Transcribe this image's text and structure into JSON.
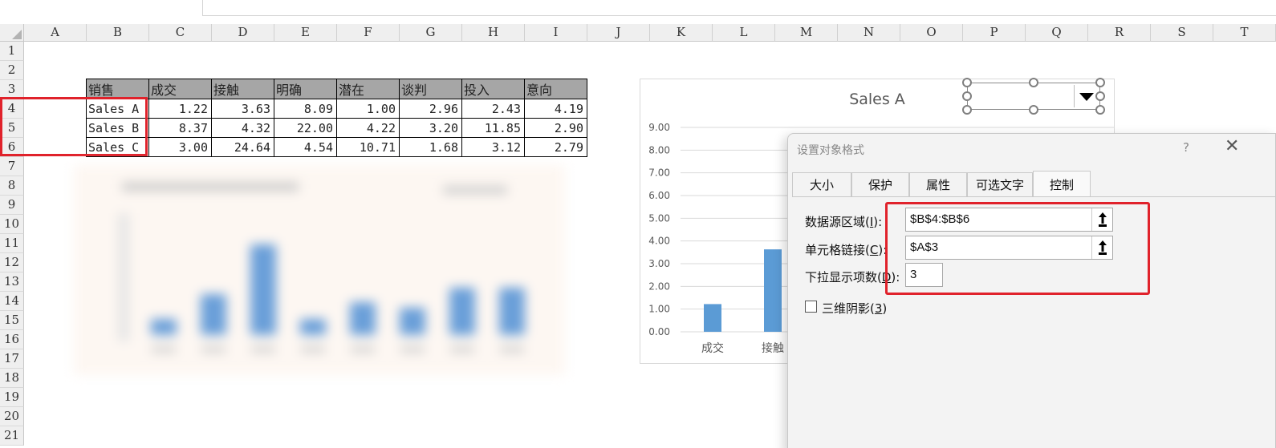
{
  "sheet": {
    "columns": [
      "A",
      "B",
      "C",
      "D",
      "E",
      "F",
      "G",
      "H",
      "I",
      "J",
      "K",
      "L",
      "M",
      "N",
      "O",
      "P",
      "Q",
      "R",
      "S",
      "T"
    ],
    "rows": [
      "1",
      "2",
      "3",
      "4",
      "5",
      "6",
      "7",
      "8",
      "9",
      "10",
      "11",
      "12",
      "13",
      "14",
      "15",
      "16",
      "17",
      "18",
      "19",
      "20",
      "21"
    ]
  },
  "table": {
    "headers": [
      "销售",
      "成交",
      "接触",
      "明确",
      "潜在",
      "谈判",
      "投入",
      "意向"
    ],
    "rows": [
      {
        "label": "Sales A",
        "values": [
          "1.22",
          "3.63",
          "8.09",
          "1.00",
          "2.96",
          "2.43",
          "4.19"
        ]
      },
      {
        "label": "Sales B",
        "values": [
          "8.37",
          "4.32",
          "22.00",
          "4.22",
          "3.20",
          "11.85",
          "2.90"
        ]
      },
      {
        "label": "Sales C",
        "values": [
          "3.00",
          "24.64",
          "4.54",
          "10.71",
          "1.68",
          "3.12",
          "2.79"
        ]
      }
    ]
  },
  "blurred_chart": {
    "values": [
      1.22,
      3.63,
      8.09,
      1.0,
      2.96,
      2.43,
      4.19,
      4.19
    ]
  },
  "chart_data": {
    "type": "bar",
    "title": "Sales A",
    "categories": [
      "成交",
      "接触"
    ],
    "values": [
      1.22,
      3.63
    ],
    "ylim": [
      0,
      9
    ],
    "yticks": [
      "0.00",
      "1.00",
      "2.00",
      "3.00",
      "4.00",
      "5.00",
      "6.00",
      "7.00",
      "8.00",
      "9.00"
    ],
    "bar_color": "#5b9bd5",
    "grid": true
  },
  "dialog": {
    "title": "设置对象格式",
    "help": "?",
    "close": "✕",
    "tabs": [
      "大小",
      "保护",
      "属性",
      "可选文字",
      "控制"
    ],
    "active_tab": "控制",
    "source_label": "数据源区域(",
    "source_key": "I",
    "source_tail": "):",
    "source_value": "$B$4:$B$6",
    "link_label": "单元格链接(",
    "link_key": "C",
    "link_tail": "):",
    "link_value": "$A$3",
    "dropdown_label": "下拉显示项数(",
    "dropdown_key": "D",
    "dropdown_tail": "):",
    "dropdown_value": "3",
    "shadow_label": "三维阴影(",
    "shadow_key": "3",
    "shadow_tail": ")"
  },
  "colors": {
    "highlight_red": "#e0222b",
    "header_gray": "#a6a6a6",
    "bar_blue": "#5b9bd5"
  }
}
